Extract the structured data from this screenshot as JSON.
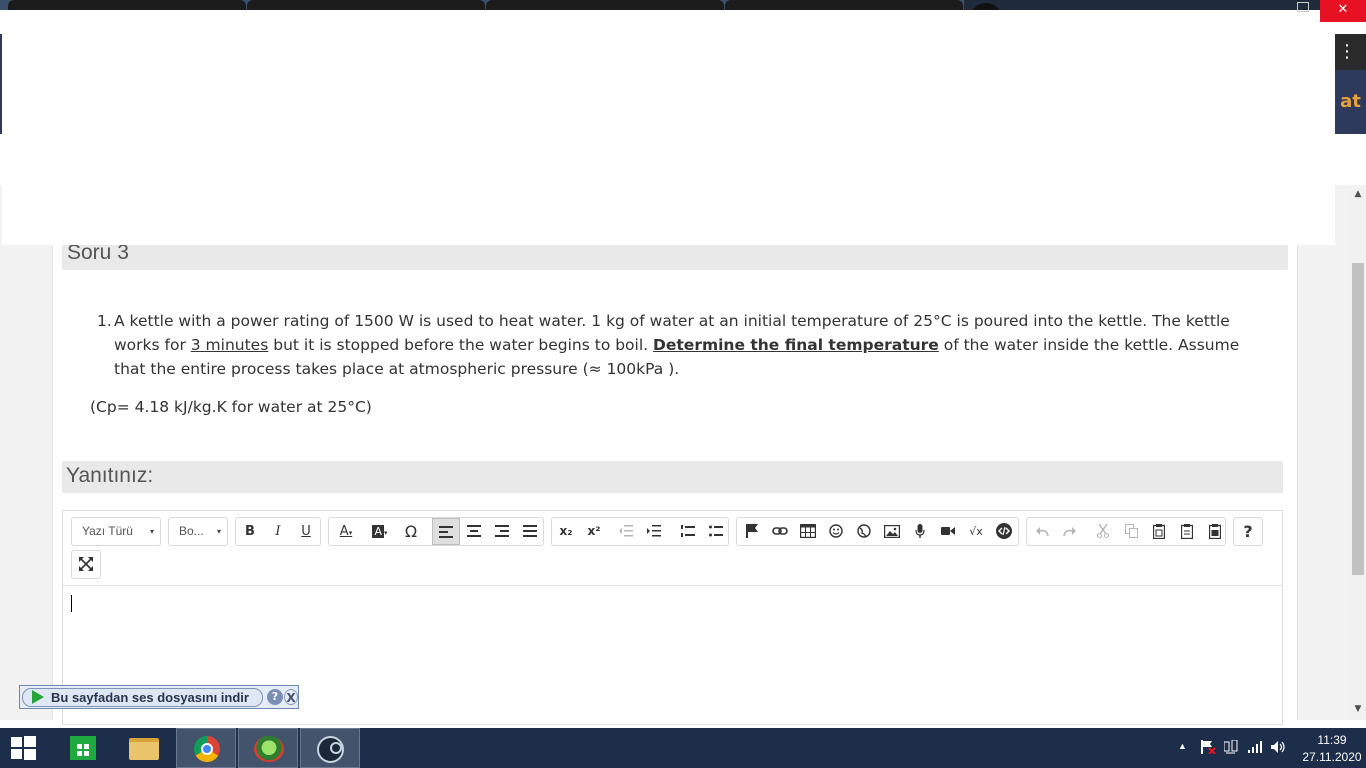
{
  "browser": {
    "close_glyph": "✕",
    "menu_glyph": "⋮",
    "banner_fragment": "at"
  },
  "question": {
    "title": "Soru 3",
    "number": "1.",
    "text_part1": "A kettle with a power rating of 1500 W is used to heat water. 1 kg of water at an initial temperature of 25°C is poured into the kettle. The kettle works for ",
    "text_underlined": "3 minutes",
    "text_part2": " but it is stopped before the water begins to boil. ",
    "text_bold_underlined": "Determine the final temperature",
    "text_part3": " of the water inside the kettle. Assume that the entire process takes place at atmospheric pressure (≈ 100kPa ).",
    "note": "(Cp= 4.18 kJ/kg.K for water at 25°C)"
  },
  "answer": {
    "title": "Yanıtınız:"
  },
  "editor": {
    "font_family_label": "Yazı Türü",
    "font_size_label": "Bo...",
    "caret": "▾",
    "bold": "B",
    "italic": "I",
    "underline": "U",
    "text_color": "A",
    "bg_color": "A",
    "special_char": "Ω",
    "subscript": "x₂",
    "superscript": "x²",
    "math": "√x",
    "help": "?"
  },
  "scrollbar": {
    "up": "▲",
    "down": "▼"
  },
  "audio_bar": {
    "label": "Bu sayfadan ses dosyasını indir",
    "help": "?",
    "close": "X"
  },
  "taskbar": {
    "time": "11:39",
    "date": "27.11.2020",
    "tray_up": "▲"
  },
  "colors": {
    "taskbar_bg": "#1c2e4a",
    "close_red": "#e81123",
    "header_grey": "#e9e9e9"
  }
}
